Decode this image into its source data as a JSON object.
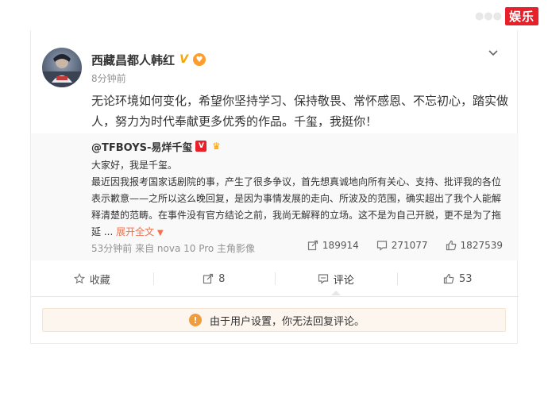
{
  "watermark": {
    "faint": "●●●",
    "badge": "娱乐"
  },
  "post": {
    "author": "西藏昌都人韩红",
    "time": "8分钟前",
    "text": "无论环境如何变化，希望你坚持学习、保持敬畏、常怀感恩、不忘初心，踏实做人，努力为时代奉献更多优秀的作品。千玺，我挺你！"
  },
  "repost": {
    "author": "@TFBOYS-易烊千玺",
    "line1": "大家好，我是千玺。",
    "body": "最近因我报考国家话剧院的事，产生了很多争议，首先想真诚地向所有关心、支持、批评我的各位表示歉意——之所以这么晚回复，是因为事情发展的走向、所波及的范围，确实超出了我个人能解释清楚的范畴。在事件没有官方结论之前，我尚无解释的立场。这不是为自己开脱，更不是为了拖延 ...",
    "expand_label": "展开全文",
    "meta": "53分钟前 来自 nova 10 Pro 主角影像",
    "stats": {
      "reposts": "189914",
      "comments": "271077",
      "likes": "1827539"
    }
  },
  "actions": {
    "favorite": "收藏",
    "repost": "8",
    "comment": "评论",
    "like": "53"
  },
  "notice": {
    "text": "由于用户设置，你无法回复评论。"
  },
  "colors": {
    "accent": "#eb7350",
    "verified": "#f7a600",
    "badge": "#e8202a",
    "notice_bg": "#fdf6ef"
  }
}
